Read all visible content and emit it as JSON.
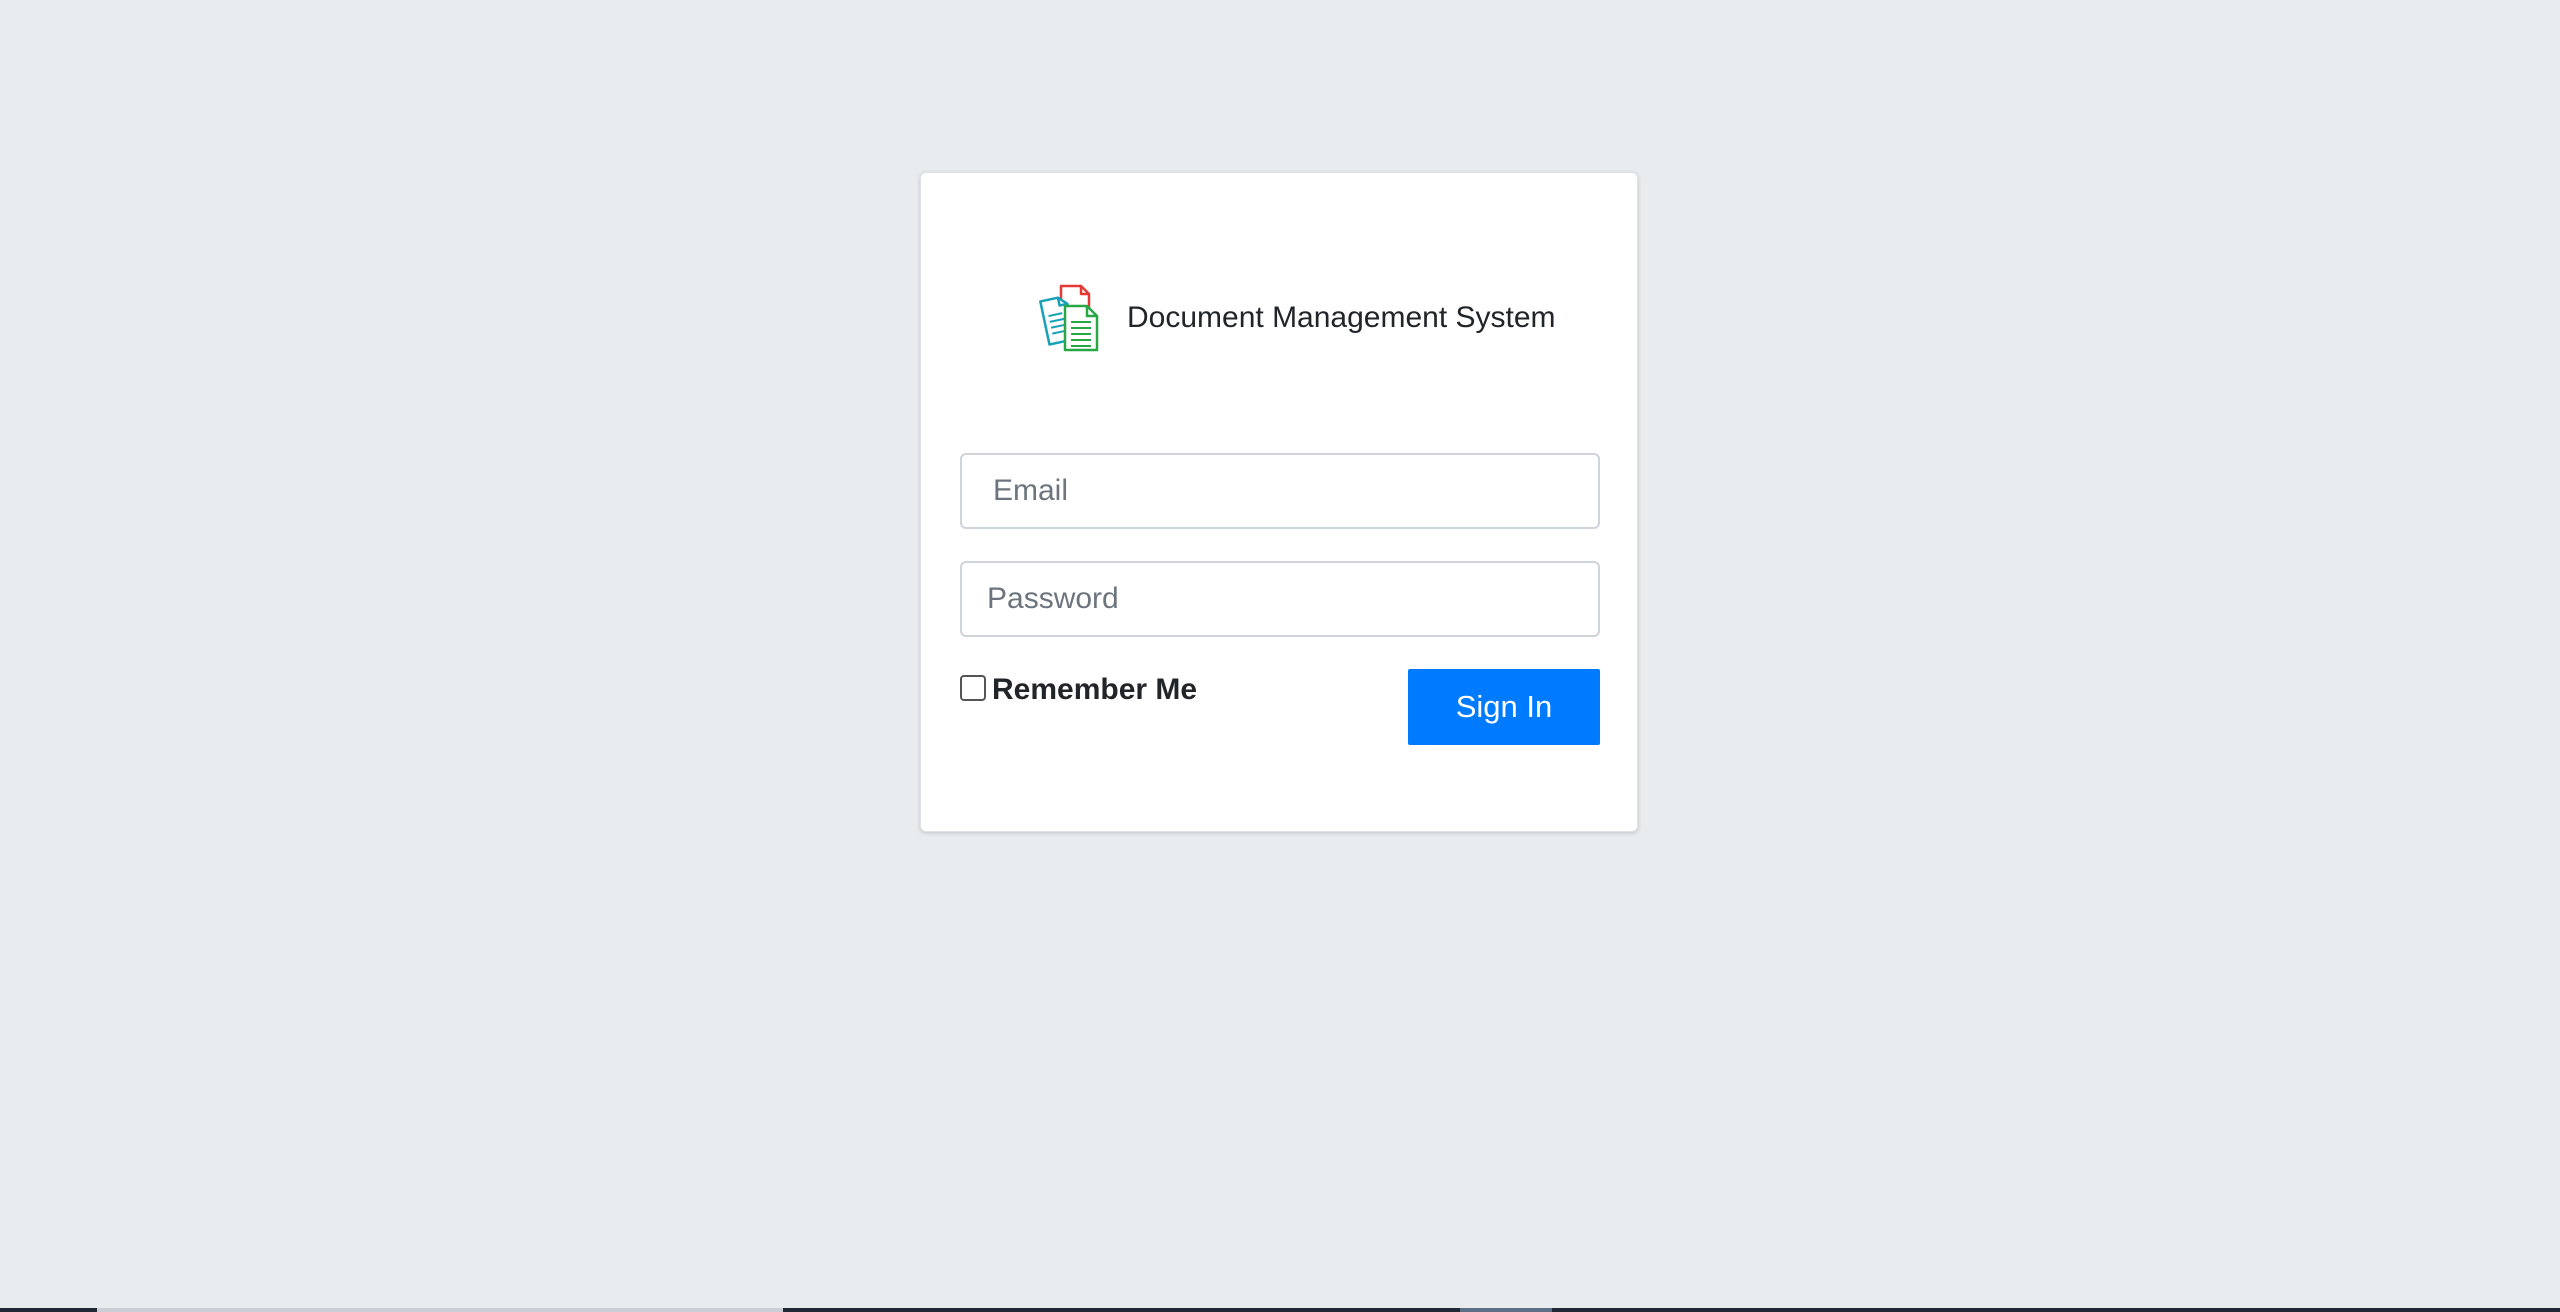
{
  "brand": {
    "title": "Document Management System",
    "logo_icon": "documents-logo-icon",
    "logo_colors": {
      "back": "#e53935",
      "middle": "#17a2b8",
      "front": "#28a745"
    }
  },
  "form": {
    "email_placeholder": "Email",
    "email_value": "",
    "password_placeholder": "Password",
    "password_value": "",
    "remember_label": "Remember Me",
    "remember_checked": false,
    "submit_label": "Sign In"
  },
  "colors": {
    "background": "#e9ecef",
    "card": "#ffffff",
    "primary": "#007bff"
  }
}
